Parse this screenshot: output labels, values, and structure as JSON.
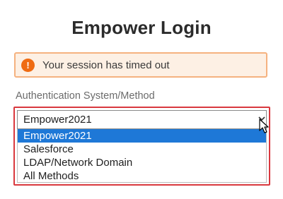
{
  "page": {
    "title": "Empower Login"
  },
  "alert": {
    "icon": "warning-icon",
    "icon_glyph": "!",
    "message": "Your session has timed out",
    "color": "#ef6b12"
  },
  "auth": {
    "label": "Authentication System/Method",
    "selected": "Empower2021",
    "options": [
      "Empower2021",
      "Salesforce",
      "LDAP/Network Domain",
      "All Methods"
    ],
    "highlighted_option": "Empower2021"
  },
  "colors": {
    "highlight_border": "#d9383e",
    "selected_option_bg": "#1e78d7"
  }
}
